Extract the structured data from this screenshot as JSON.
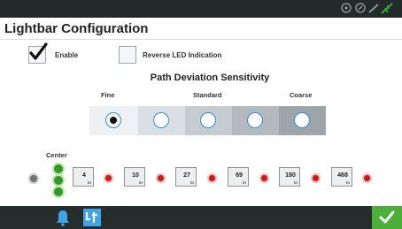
{
  "status": {
    "icons": [
      "gps-icon",
      "signal-icon",
      "wifi-icon",
      "satellite-icon"
    ]
  },
  "title": "Lightbar Configuration",
  "enable": {
    "label": "Enable",
    "checked": true
  },
  "reverse_led": {
    "label": "Reverse LED Indication",
    "checked": false
  },
  "sensitivity": {
    "title": "Path Deviation Sensitivity",
    "labels": [
      "Fine",
      "Standard",
      "Coarse"
    ],
    "selected_index": 0,
    "options": 5
  },
  "lightbar": {
    "center_label": "Center",
    "distances": [
      "4",
      "10",
      "27",
      "69",
      "180",
      "468"
    ],
    "unit": "in"
  },
  "bottom": {
    "icons": [
      "alarm-bell-icon",
      "gps-guidance-icon"
    ],
    "confirm": "checkmark-icon"
  },
  "colors": {
    "accent": "#2b8ed6",
    "led_green": "#2e9a2e",
    "led_red": "#cc1818",
    "confirm": "#4caf3a"
  }
}
